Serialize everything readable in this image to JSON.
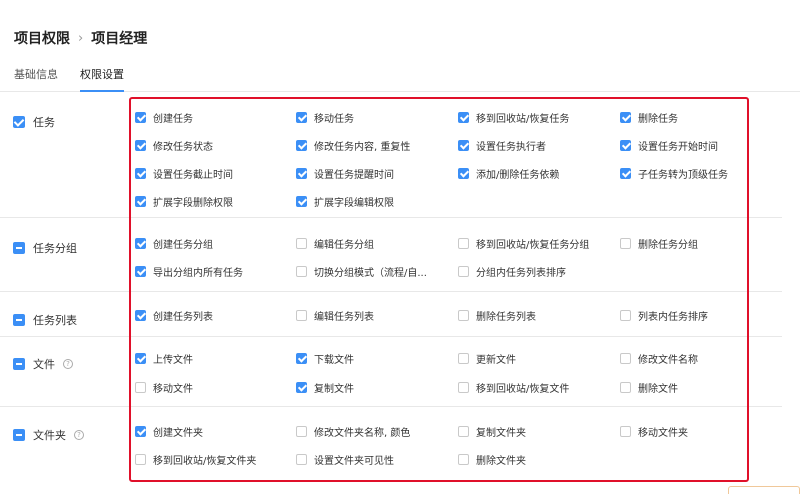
{
  "breadcrumb": {
    "parent": "项目权限",
    "separator": "›",
    "current": "项目经理"
  },
  "tabs": [
    {
      "label": "基础信息",
      "active": false
    },
    {
      "label": "权限设置",
      "active": true
    }
  ],
  "accent_color": "#3b8ff6",
  "highlight_color": "#e0102a",
  "sections": [
    {
      "label": "任务",
      "state": "checked",
      "help": false,
      "rows": [
        [
          {
            "label": "创建任务",
            "checked": true
          },
          {
            "label": "移动任务",
            "checked": true
          },
          {
            "label": "移到回收站/恢复任务",
            "checked": true
          },
          {
            "label": "删除任务",
            "checked": true
          }
        ],
        [
          {
            "label": "修改任务状态",
            "checked": true
          },
          {
            "label": "修改任务内容, 重复性",
            "checked": true
          },
          {
            "label": "设置任务执行者",
            "checked": true
          },
          {
            "label": "设置任务开始时间",
            "checked": true
          }
        ],
        [
          {
            "label": "设置任务截止时间",
            "checked": true
          },
          {
            "label": "设置任务提醒时间",
            "checked": true
          },
          {
            "label": "添加/删除任务依赖",
            "checked": true
          },
          {
            "label": "子任务转为顶级任务",
            "checked": true
          }
        ],
        [
          {
            "label": "扩展字段删除权限",
            "checked": true
          },
          {
            "label": "扩展字段编辑权限",
            "checked": true
          }
        ]
      ]
    },
    {
      "label": "任务分组",
      "state": "partial",
      "help": false,
      "rows": [
        [
          {
            "label": "创建任务分组",
            "checked": true
          },
          {
            "label": "编辑任务分组",
            "checked": false
          },
          {
            "label": "移到回收站/恢复任务分组",
            "checked": false
          },
          {
            "label": "删除任务分组",
            "checked": false
          }
        ],
        [
          {
            "label": "导出分组内所有任务",
            "checked": true
          },
          {
            "label": "切换分组模式（流程/自...",
            "checked": false
          },
          {
            "label": "分组内任务列表排序",
            "checked": false
          }
        ]
      ]
    },
    {
      "label": "任务列表",
      "state": "partial",
      "help": false,
      "rows": [
        [
          {
            "label": "创建任务列表",
            "checked": true
          },
          {
            "label": "编辑任务列表",
            "checked": false
          },
          {
            "label": "删除任务列表",
            "checked": false
          },
          {
            "label": "列表内任务排序",
            "checked": false
          }
        ]
      ]
    },
    {
      "label": "文件",
      "state": "partial",
      "help": true,
      "rows": [
        [
          {
            "label": "上传文件",
            "checked": true
          },
          {
            "label": "下载文件",
            "checked": true
          },
          {
            "label": "更新文件",
            "checked": false
          },
          {
            "label": "修改文件名称",
            "checked": false
          }
        ],
        [
          {
            "label": "移动文件",
            "checked": false
          },
          {
            "label": "复制文件",
            "checked": true
          },
          {
            "label": "移到回收站/恢复文件",
            "checked": false
          },
          {
            "label": "删除文件",
            "checked": false
          }
        ]
      ]
    },
    {
      "label": "文件夹",
      "state": "partial",
      "help": true,
      "rows": [
        [
          {
            "label": "创建文件夹",
            "checked": true
          },
          {
            "label": "修改文件夹名称, 颜色",
            "checked": false
          },
          {
            "label": "复制文件夹",
            "checked": false
          },
          {
            "label": "移动文件夹",
            "checked": false
          }
        ],
        [
          {
            "label": "移到回收站/恢复文件夹",
            "checked": false
          },
          {
            "label": "设置文件夹可见性",
            "checked": false
          },
          {
            "label": "删除文件夹",
            "checked": false
          }
        ]
      ]
    }
  ]
}
